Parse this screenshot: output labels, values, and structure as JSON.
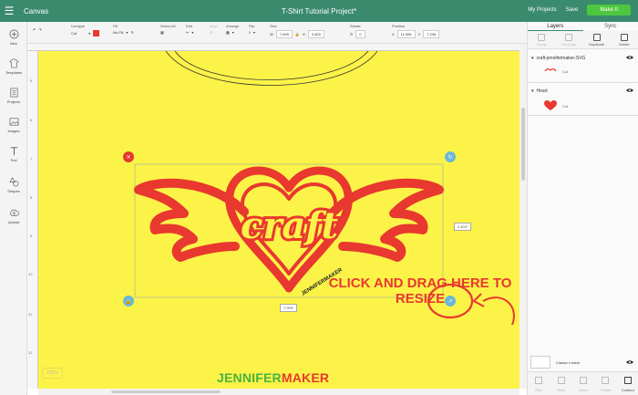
{
  "header": {
    "app_name": "Canvas",
    "project_title": "T-Shirt Tutorial Project*",
    "my_projects": "My Projects",
    "save": "Save",
    "make_it": "Make It"
  },
  "toolbar": {
    "linetype_label": "Linetype",
    "linetype_value": "Cut",
    "fill_label": "Fill",
    "fill_value": "No Fill",
    "select_all": "Select All",
    "edit": "Edit",
    "align": "Align",
    "arrange": "Arrange",
    "flip": "Flip",
    "size": "Size",
    "size_w_label": "W",
    "size_w": "7.999",
    "size_h_label": "H",
    "size_h": "3.403",
    "rotate": "Rotate",
    "rotate_value": "0",
    "position": "Position",
    "pos_x_label": "X",
    "pos_x": "11.596",
    "pos_y_label": "Y",
    "pos_y": "7.236",
    "linetype_color": "#e8382f"
  },
  "sidebar": {
    "items": [
      {
        "label": "New",
        "icon": "plus-circle-icon"
      },
      {
        "label": "Templates",
        "icon": "tshirt-icon"
      },
      {
        "label": "Projects",
        "icon": "projects-icon"
      },
      {
        "label": "Images",
        "icon": "images-icon"
      },
      {
        "label": "Text",
        "icon": "text-icon"
      },
      {
        "label": "Shapes",
        "icon": "shapes-icon"
      },
      {
        "label": "Upload",
        "icon": "upload-icon"
      }
    ]
  },
  "ruler": {
    "left": [
      "5",
      "6",
      "7",
      "8",
      "9",
      "10",
      "11",
      "12"
    ]
  },
  "canvas": {
    "zoom": "125%",
    "bg_color": "#fcf348",
    "design_color": "#e8382f",
    "design_text": "craft",
    "tagline": "JENNIFERMAKER",
    "width_dim": "7.999\"",
    "height_dim": "3.403\"",
    "logo_part1": "JENNIFER",
    "logo_part2": "MAKER",
    "annotation": "CLICK AND DRAG HERE TO RESIZE"
  },
  "layers": {
    "tab_layers": "Layers",
    "tab_sync": "Sync",
    "tools": [
      "Group",
      "UnGroup",
      "Duplicate",
      "Delete"
    ],
    "groups": [
      {
        "name": "craft-jennifermaker-SVG",
        "sub": "Cut"
      },
      {
        "name": "Heart",
        "sub": "Cut"
      }
    ],
    "canvas_item": "Classic t-shirts",
    "bottom_tools": [
      "Slice",
      "Weld",
      "Attach",
      "Flatten",
      "Contour"
    ]
  }
}
